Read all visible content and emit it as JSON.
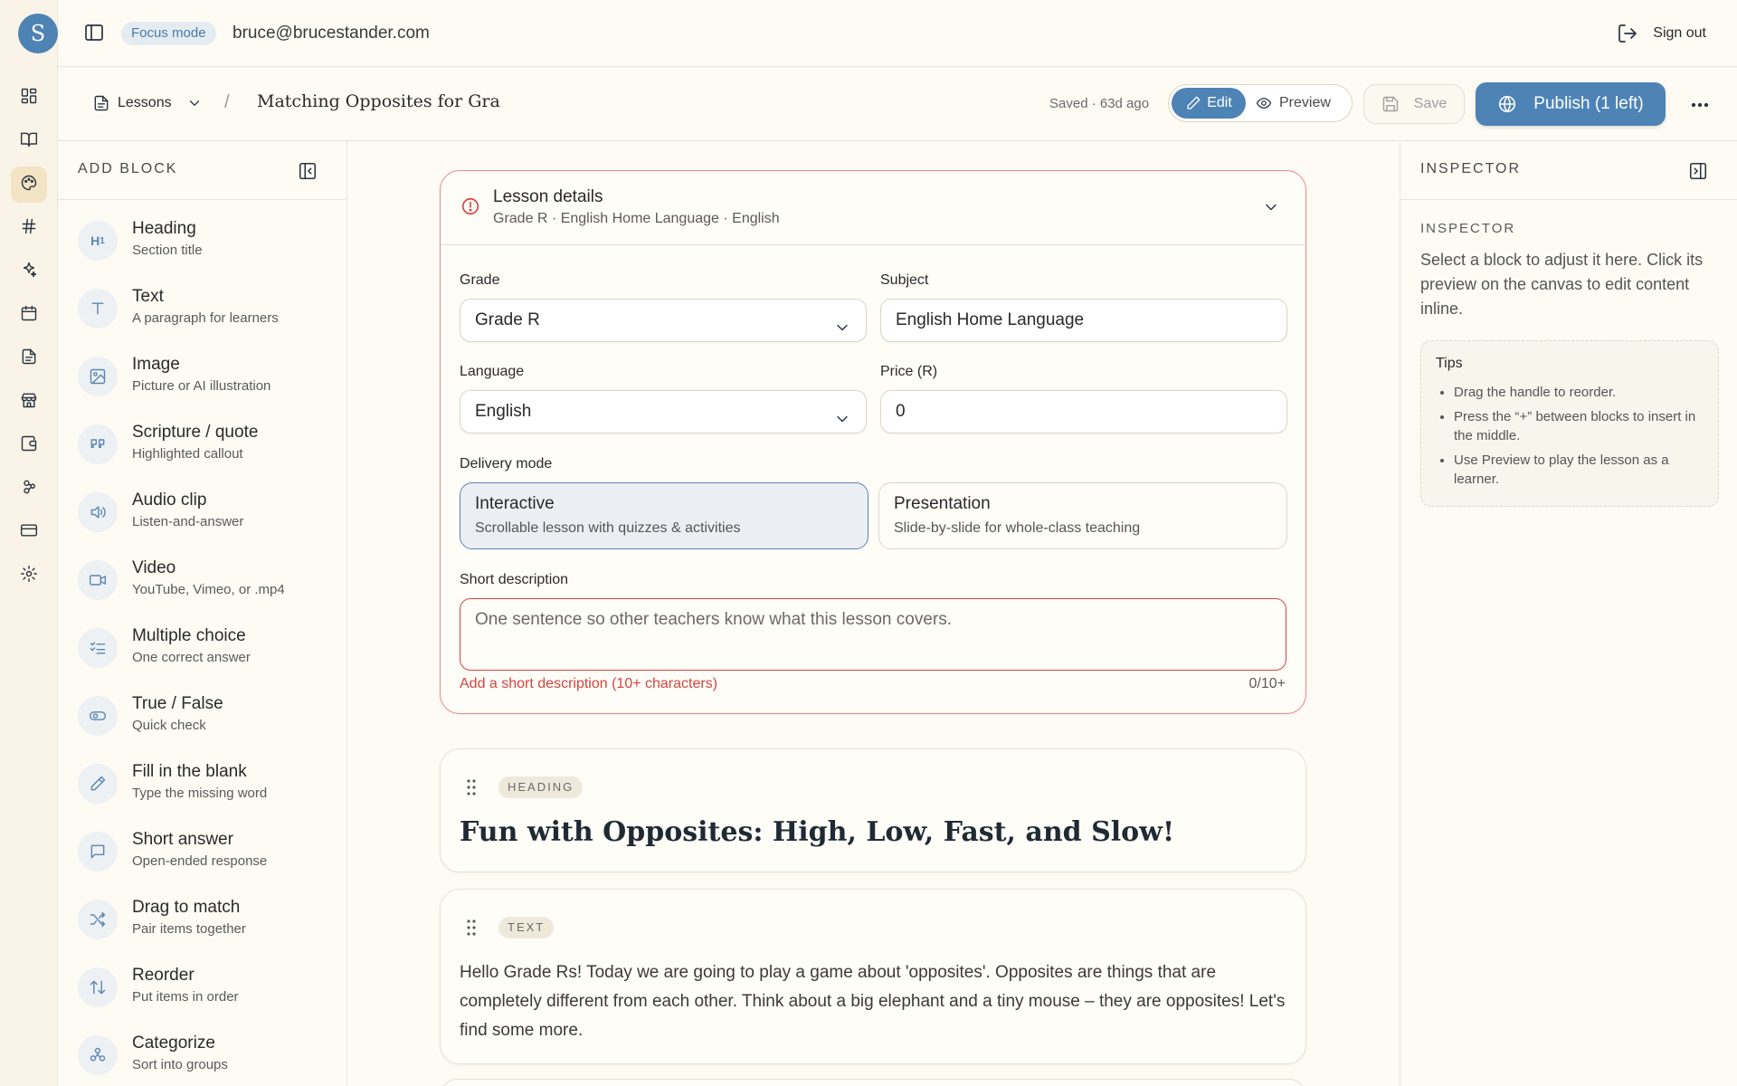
{
  "user": {
    "avatar_letter": "S",
    "email": "bruce@brucestander.com",
    "focus_label": "Focus mode",
    "signout_label": "Sign out"
  },
  "rail": {
    "items": [
      {
        "icon": "dashboard-icon"
      },
      {
        "icon": "book-icon"
      },
      {
        "icon": "palette-icon",
        "active": true
      },
      {
        "icon": "hash-icon"
      },
      {
        "icon": "sparkle-icon"
      },
      {
        "icon": "calendar-icon"
      },
      {
        "icon": "document-icon"
      },
      {
        "icon": "store-icon"
      },
      {
        "icon": "wallet-icon"
      },
      {
        "icon": "community-icon"
      },
      {
        "icon": "card-icon"
      },
      {
        "icon": "settings-icon"
      }
    ]
  },
  "toolbar": {
    "breadcrumb_root": "Lessons",
    "breadcrumb_sep": "/",
    "lesson_title": "Matching Opposites for Gra",
    "saved_status": "Saved · 63d ago",
    "edit_label": "Edit",
    "preview_label": "Preview",
    "save_label": "Save",
    "publish_label": "Publish (1 left)",
    "accent_color": "#4e83b5"
  },
  "add_block": {
    "title": "ADD BLOCK",
    "items": [
      {
        "name": "Heading",
        "desc": "Section title",
        "icon": "heading-icon"
      },
      {
        "name": "Text",
        "desc": "A paragraph for learners",
        "icon": "text-icon"
      },
      {
        "name": "Image",
        "desc": "Picture or AI illustration",
        "icon": "image-icon"
      },
      {
        "name": "Scripture / quote",
        "desc": "Highlighted callout",
        "icon": "quote-icon"
      },
      {
        "name": "Audio clip",
        "desc": "Listen-and-answer",
        "icon": "audio-icon"
      },
      {
        "name": "Video",
        "desc": "YouTube, Vimeo, or .mp4",
        "icon": "video-icon"
      },
      {
        "name": "Multiple choice",
        "desc": "One correct answer",
        "icon": "checklist-icon"
      },
      {
        "name": "True / False",
        "desc": "Quick check",
        "icon": "toggle-icon"
      },
      {
        "name": "Fill in the blank",
        "desc": "Type the missing word",
        "icon": "pencil-icon"
      },
      {
        "name": "Short answer",
        "desc": "Open-ended response",
        "icon": "message-icon"
      },
      {
        "name": "Drag to match",
        "desc": "Pair items together",
        "icon": "shuffle-icon"
      },
      {
        "name": "Reorder",
        "desc": "Put items in order",
        "icon": "reorder-icon"
      },
      {
        "name": "Categorize",
        "desc": "Sort into groups",
        "icon": "categorize-icon"
      }
    ]
  },
  "inspector": {
    "title": "INSPECTOR",
    "subtitle": "INSPECTOR",
    "description": "Select a block to adjust it here. Click its preview on the canvas to edit content inline.",
    "tips_title": "Tips",
    "tips": [
      "Drag the handle to reorder.",
      "Press the “+” between blocks to insert in the middle.",
      "Use Preview to play the lesson as a learner."
    ]
  },
  "lesson_details": {
    "title": "Lesson details",
    "subtitle": "Grade R · English Home Language · English",
    "grade_label": "Grade",
    "grade_value": "Grade R",
    "subject_label": "Subject",
    "subject_value": "English Home Language",
    "language_label": "Language",
    "language_value": "English",
    "price_label": "Price (R)",
    "price_value": "0",
    "delivery_label": "Delivery mode",
    "modes": [
      {
        "title": "Interactive",
        "desc": "Scrollable lesson with quizzes & activities",
        "selected": true
      },
      {
        "title": "Presentation",
        "desc": "Slide-by-slide for whole-class teaching",
        "selected": false
      }
    ],
    "short_desc_label": "Short description",
    "short_desc_placeholder": "One sentence so other teachers know what this lesson covers.",
    "short_desc_error": "Add a short description (10+ characters)",
    "short_desc_count": "0/10+",
    "error_color": "#d8433e"
  },
  "blocks": [
    {
      "tag": "HEADING",
      "content": "Fun with Opposites: High, Low, Fast, and Slow!"
    },
    {
      "tag": "TEXT",
      "content": "Hello Grade Rs! Today we are going to play a game about 'opposites'. Opposites are things that are completely different from each other. Think about a big elephant and a tiny mouse – they are opposites! Let's find some more."
    }
  ]
}
